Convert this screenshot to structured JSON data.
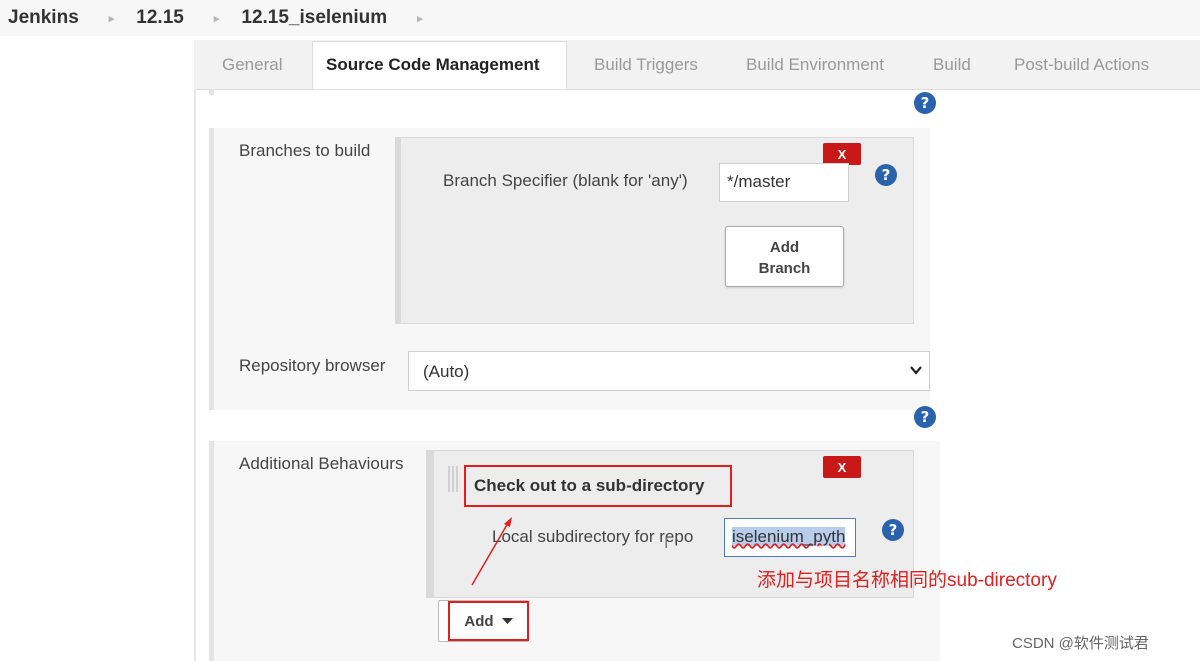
{
  "breadcrumb": {
    "items": [
      "Jenkins",
      "12.15",
      "12.15_iselenium"
    ],
    "separator": "▸"
  },
  "tabs": [
    {
      "label": "General",
      "active": false
    },
    {
      "label": "Source Code Management",
      "active": true
    },
    {
      "label": "Build Triggers",
      "active": false
    },
    {
      "label": "Build Environment",
      "active": false
    },
    {
      "label": "Build",
      "active": false
    },
    {
      "label": "Post-build Actions",
      "active": false
    }
  ],
  "help_icon": "?",
  "branches": {
    "section_label": "Branches to build",
    "delete_label": "X",
    "specifier_label": "Branch Specifier (blank for 'any')",
    "specifier_value": "*/master",
    "add_branch_line1": "Add",
    "add_branch_line2": "Branch"
  },
  "repo_browser": {
    "label": "Repository browser",
    "value": "(Auto)"
  },
  "behaviours": {
    "section_label": "Additional Behaviours",
    "delete_label": "X",
    "item_title": "Check out to a sub-directory",
    "subdir_label": "Local subdirectory for repo",
    "subdir_value": "iselenium_pyth",
    "add_label": "Add"
  },
  "annotation": "添加与项目名称相同的sub-directory",
  "watermark": "CSDN @软件测试君",
  "colors": {
    "help_blue": "#2a62ad",
    "delete_red": "#c81818",
    "annotation_red": "#e02020"
  },
  "icons": {
    "help": "help-icon",
    "delete": "delete-icon",
    "dropdown": "chevron-down-icon",
    "caret": "caret-down-icon"
  }
}
